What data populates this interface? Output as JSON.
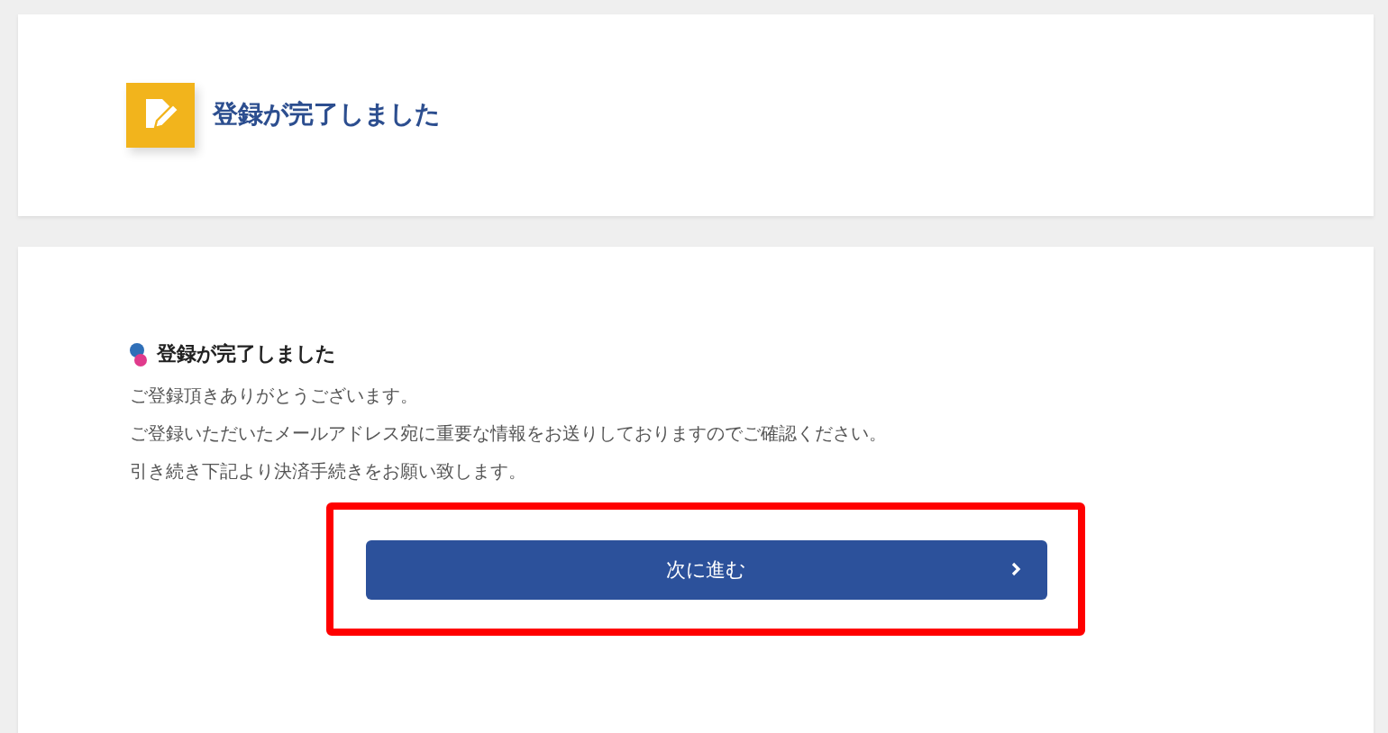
{
  "header": {
    "title": "登録が完了しました"
  },
  "content": {
    "heading": "登録が完了しました",
    "paragraphs": [
      "ご登録頂きありがとうございます。",
      "ご登録いただいたメールアドレス宛に重要な情報をお送りしておりますのでご確認ください。",
      "引き続き下記より決済手続きをお願い致します。"
    ],
    "button": {
      "label": "次に進む"
    },
    "highlighted": true
  }
}
